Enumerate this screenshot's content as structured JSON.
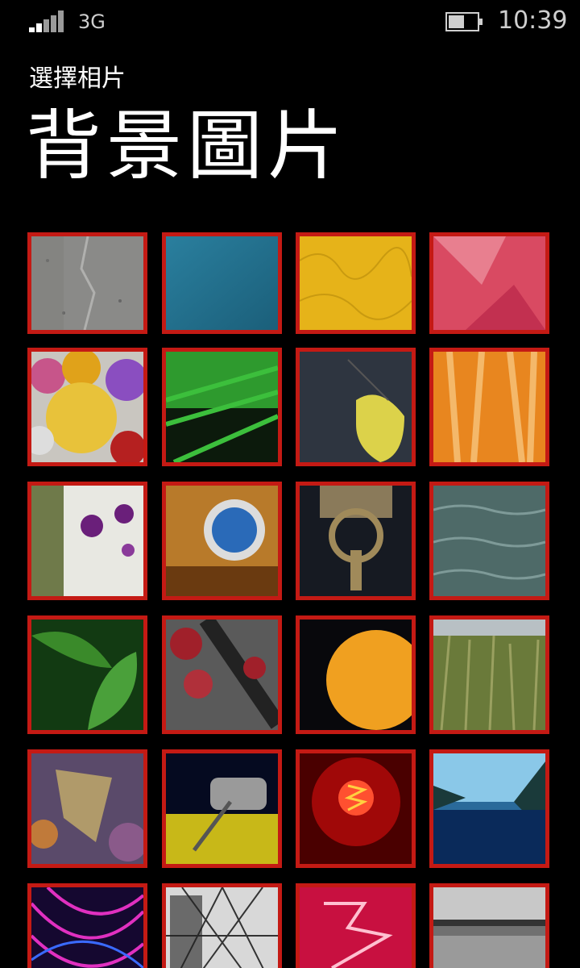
{
  "status_bar": {
    "network": "3G",
    "time": "10:39",
    "signal_icon": "signal-bars-icon",
    "battery_icon": "battery-icon",
    "battery_level": 0.55
  },
  "header": {
    "subtitle": "選擇相片",
    "title": "背景圖片"
  },
  "colors": {
    "background": "#000000",
    "accent_border": "#c41a14",
    "text": "#ffffff"
  },
  "photos": [
    {
      "id": "concrete"
    },
    {
      "id": "blue-texture"
    },
    {
      "id": "yellow-pattern"
    },
    {
      "id": "pink-petals"
    },
    {
      "id": "glass-marbles"
    },
    {
      "id": "green-stems"
    },
    {
      "id": "yellow-leaf"
    },
    {
      "id": "orange-wood"
    },
    {
      "id": "purple-berries"
    },
    {
      "id": "motorcycle-headlight"
    },
    {
      "id": "door-knocker"
    },
    {
      "id": "water-waves"
    },
    {
      "id": "green-leaves"
    },
    {
      "id": "ivy-stairs"
    },
    {
      "id": "orange-sphere"
    },
    {
      "id": "tall-grass"
    },
    {
      "id": "autumn-leaves"
    },
    {
      "id": "car-mirror"
    },
    {
      "id": "light-bulb"
    },
    {
      "id": "blue-lake"
    },
    {
      "id": "light-trails"
    },
    {
      "id": "ferris-wheel"
    },
    {
      "id": "neon-sign"
    },
    {
      "id": "beach-sunset"
    }
  ]
}
